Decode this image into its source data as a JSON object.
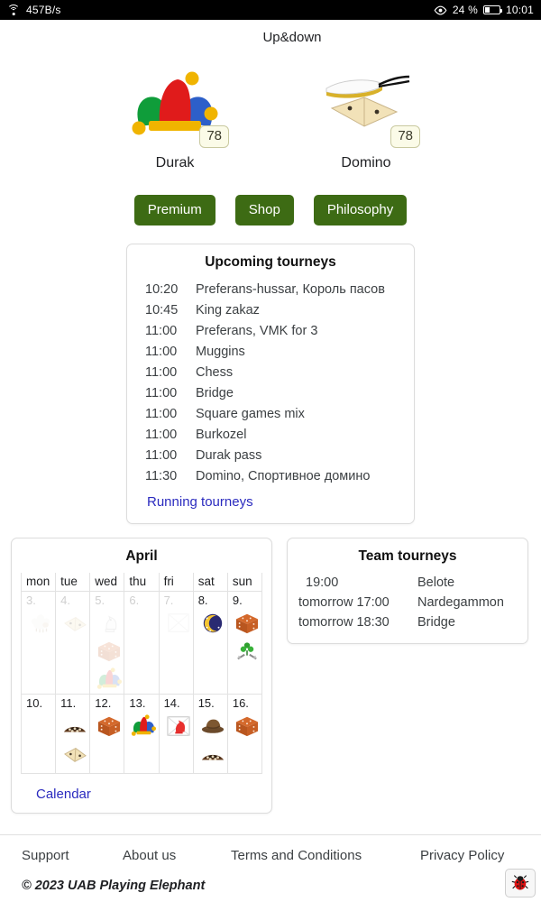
{
  "statusbar": {
    "network_speed": "457B/s",
    "battery_percent": "24 %",
    "clock": "10:01",
    "wifi_icon": "wifi-icon",
    "eye_icon": "eye-icon",
    "battery_icon": "battery-icon"
  },
  "header": {
    "title": "Up&down"
  },
  "games": [
    {
      "name": "Durak",
      "badge": "78",
      "icon": "jester-hat-icon"
    },
    {
      "name": "Domino",
      "badge": "78",
      "icon": "domino-tile-icon"
    }
  ],
  "buttons": {
    "premium": "Premium",
    "shop": "Shop",
    "philosophy": "Philosophy",
    "color": "#3d6b14"
  },
  "upcoming": {
    "title": "Upcoming tourneys",
    "rows": [
      {
        "time": "10:20",
        "name": "Preferans-hussar, Король пасов"
      },
      {
        "time": "10:45",
        "name": "King zakaz"
      },
      {
        "time": "11:00",
        "name": "Preferans, VMK for 3"
      },
      {
        "time": "11:00",
        "name": "Muggins"
      },
      {
        "time": "11:00",
        "name": "Chess"
      },
      {
        "time": "11:00",
        "name": "Bridge"
      },
      {
        "time": "11:00",
        "name": "Square games mix"
      },
      {
        "time": "11:00",
        "name": "Burkozel"
      },
      {
        "time": "11:00",
        "name": "Durak pass"
      },
      {
        "time": "11:30",
        "name": "Domino, Спортивное домино"
      }
    ],
    "link": "Running tourneys",
    "link_color": "#2b2bbf"
  },
  "calendar": {
    "month": "April",
    "weekdays": [
      "mon",
      "tue",
      "wed",
      "thu",
      "fri",
      "sat",
      "sun"
    ],
    "weeks": [
      [
        {
          "day": "3.",
          "past": true,
          "icons": [
            "sheep-icon"
          ]
        },
        {
          "day": "4.",
          "past": true,
          "icons": [
            "domino-tile-icon"
          ]
        },
        {
          "day": "5.",
          "past": true,
          "icons": [
            "chess-knight-icon",
            "dice-icon",
            "jester-hat-icon"
          ]
        },
        {
          "day": "6.",
          "past": true,
          "icons": []
        },
        {
          "day": "7.",
          "past": true,
          "icons": [
            "framed-piece-icon"
          ]
        },
        {
          "day": "8.",
          "past": false,
          "icons": [
            "moon-icon"
          ]
        },
        {
          "day": "9.",
          "past": false,
          "icons": [
            "dice-icon",
            "clover-icon"
          ]
        }
      ],
      [
        {
          "day": "10.",
          "past": false,
          "icons": []
        },
        {
          "day": "11.",
          "past": false,
          "icons": [
            "checkers-board-icon",
            "domino-tile-icon"
          ]
        },
        {
          "day": "12.",
          "past": false,
          "icons": [
            "dice-icon"
          ]
        },
        {
          "day": "13.",
          "past": false,
          "icons": [
            "jester-hat-icon"
          ]
        },
        {
          "day": "14.",
          "past": false,
          "icons": [
            "red-knight-icon"
          ]
        },
        {
          "day": "15.",
          "past": false,
          "icons": [
            "hat-icon",
            "checkers-board-icon"
          ]
        },
        {
          "day": "16.",
          "past": false,
          "icons": [
            "dice-icon"
          ]
        }
      ]
    ],
    "link": "Calendar"
  },
  "team": {
    "title": "Team tourneys",
    "rows": [
      {
        "time": "19:00",
        "name": "Belote",
        "short": true
      },
      {
        "time": "tomorrow 17:00",
        "name": "Nardegammon",
        "short": false
      },
      {
        "time": "tomorrow 18:30",
        "name": "Bridge",
        "short": false
      }
    ]
  },
  "footer": {
    "links": [
      "Support",
      "About us",
      "Terms and Conditions",
      "Privacy Policy"
    ],
    "copyright": "© 2023 UAB Playing Elephant",
    "bug_button_icon": "ladybug-icon"
  }
}
